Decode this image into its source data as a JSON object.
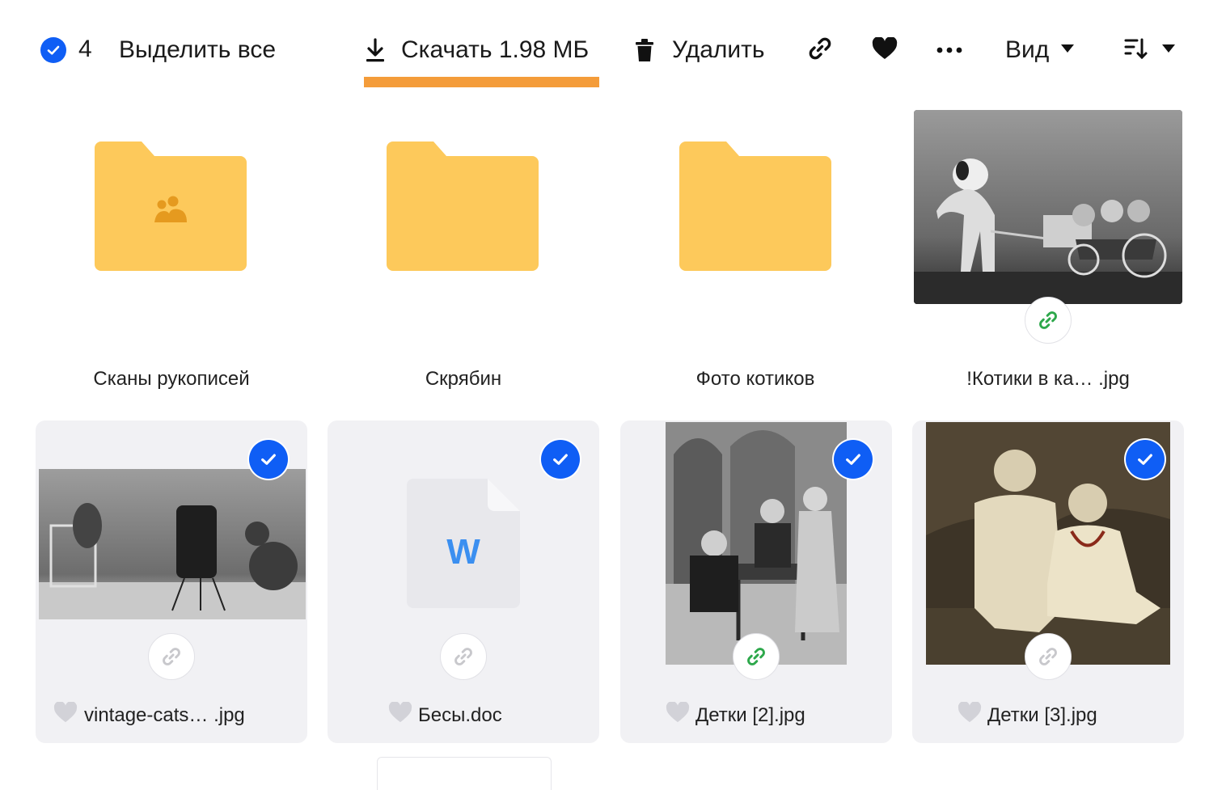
{
  "toolbar": {
    "selected_count": "4",
    "select_all_label": "Выделить все",
    "download_label": "Скачать 1.98 МБ",
    "delete_label": "Удалить",
    "view_label": "Вид",
    "accent_color": "#0f5ef5",
    "highlight_color": "#f49c3a"
  },
  "folders": [
    {
      "name": "Сканы рукописей",
      "shared": true
    },
    {
      "name": "Скрябин",
      "shared": false
    },
    {
      "name": "Фото котиков",
      "shared": false
    }
  ],
  "top_image": {
    "name": "!Котики в ка… .jpg",
    "link_active": true
  },
  "files": [
    {
      "name": "vintage-cats… .jpg",
      "selected": true,
      "link_active": false,
      "type": "image"
    },
    {
      "name": "Бесы.doc",
      "selected": true,
      "link_active": false,
      "type": "doc",
      "doc_letter": "W"
    },
    {
      "name": "Детки [2].jpg",
      "selected": true,
      "link_active": true,
      "type": "image"
    },
    {
      "name": "Детки [3].jpg",
      "selected": true,
      "link_active": false,
      "type": "image"
    }
  ],
  "colors": {
    "folder": "#fdc95b",
    "link_active": "#2da84b",
    "link_inactive": "#c8c8cc",
    "card_bg": "#f1f1f4"
  }
}
